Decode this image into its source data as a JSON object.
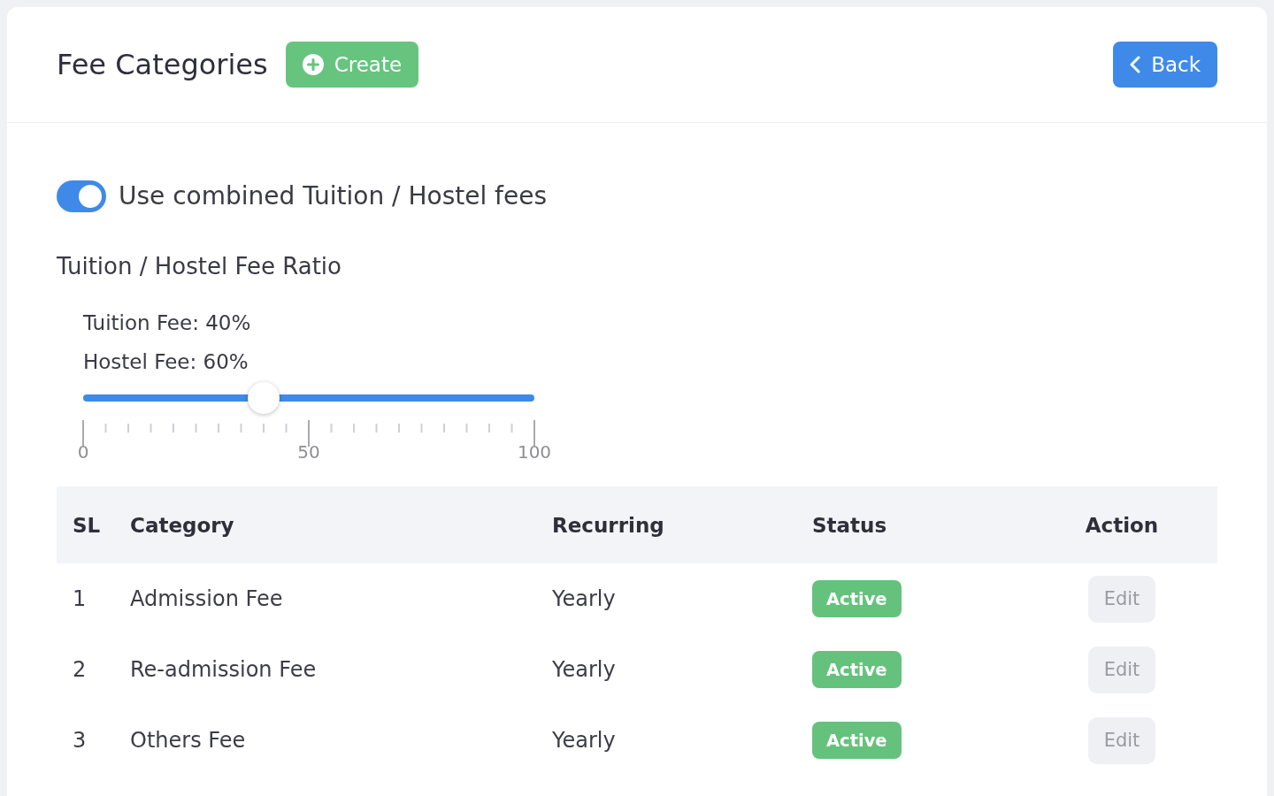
{
  "header": {
    "title": "Fee Categories",
    "create_button": "Create",
    "back_button": "Back"
  },
  "combined_fees": {
    "label": "Use combined Tuition / Hostel fees",
    "on": true
  },
  "ratio": {
    "title": "Tuition / Hostel Fee Ratio",
    "readings": [
      "Tuition Fee: 40%",
      "Hostel Fee: 60%"
    ],
    "level": 0.4,
    "scale_labels": [
      "0",
      "50",
      "100"
    ]
  },
  "table": {
    "columns": [
      "SL",
      "Category",
      "Recurring",
      "Status",
      "Action"
    ],
    "rows": [
      {
        "sl": "1",
        "category": "Admission Fee",
        "recurring": "Yearly",
        "status": "Active",
        "action": "Edit"
      },
      {
        "sl": "2",
        "category": "Re-admission Fee",
        "recurring": "Yearly",
        "status": "Active",
        "action": "Edit"
      },
      {
        "sl": "3",
        "category": "Others Fee",
        "recurring": "Yearly",
        "status": "Active",
        "action": "Edit"
      }
    ]
  }
}
